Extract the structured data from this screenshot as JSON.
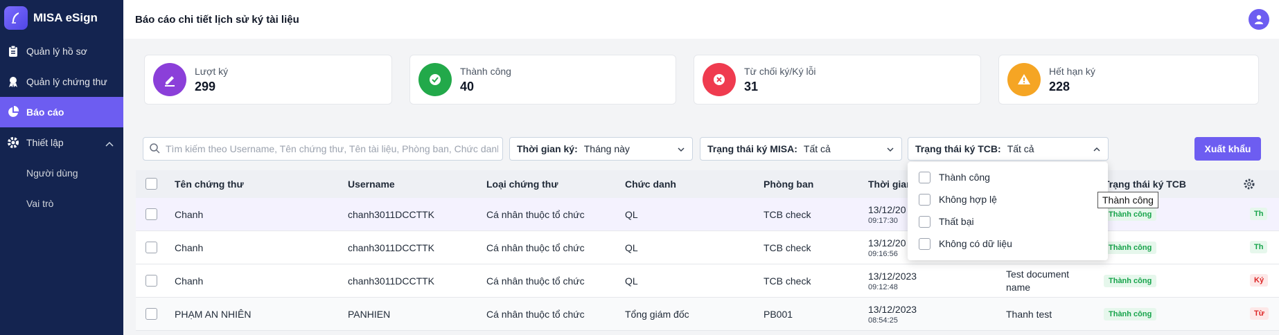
{
  "app": {
    "title": "MISA eSign"
  },
  "sidebar": {
    "items": [
      {
        "label": "Quản lý hồ sơ",
        "icon": "clipboard-icon"
      },
      {
        "label": "Quản lý chứng thư",
        "icon": "certificate-icon"
      },
      {
        "label": "Báo cáo",
        "icon": "pie-chart-icon",
        "active": true
      },
      {
        "label": "Thiết lập",
        "icon": "gear-icon",
        "expanded": true
      }
    ],
    "subitems": [
      "Người dùng",
      "Vai trò"
    ]
  },
  "header": {
    "title": "Báo cáo chi tiết lịch sử ký tài liệu"
  },
  "stats": [
    {
      "label": "Lượt ký",
      "value": "299",
      "color": "#8b3fd9",
      "icon": "signature-icon"
    },
    {
      "label": "Thành công",
      "value": "40",
      "color": "#22a94a",
      "icon": "check-circle-icon"
    },
    {
      "label": "Từ chối ký/Ký lỗi",
      "value": "31",
      "color": "#ef3b4f",
      "icon": "x-circle-icon"
    },
    {
      "label": "Hết hạn ký",
      "value": "228",
      "color": "#f5a524",
      "icon": "warning-icon"
    }
  ],
  "filters": {
    "search_placeholder": "Tìm kiếm theo Username, Tên chứng thư, Tên tài liệu, Phòng ban, Chức danh",
    "sign_time": {
      "label": "Thời gian ký:",
      "value": "Tháng này"
    },
    "misa_status": {
      "label": "Trạng thái ký MISA:",
      "value": "Tất cả"
    },
    "tcb_status": {
      "label": "Trạng thái ký TCB:",
      "value": "Tất cả"
    },
    "export_label": "Xuất khẩu"
  },
  "dropdown": {
    "options": [
      "Thành công",
      "Không hợp lệ",
      "Thất bại",
      "Không có dữ liệu"
    ],
    "tooltip": "Thành công"
  },
  "table": {
    "columns": [
      "Tên chứng thư",
      "Username",
      "Loại chứng thư",
      "Chức danh",
      "Phòng ban",
      "Thời gian",
      "",
      "Trạng thái ký TCB"
    ],
    "rows": [
      {
        "cert_name": "Chanh",
        "username": "chanh3011DCCTTK",
        "cert_type": "Cá nhân thuộc tổ chức",
        "title": "QL",
        "department": "TCB check",
        "date": "13/12/20",
        "time": "09:17:30",
        "doc_name": "",
        "tcb_status": "Thành công",
        "next": "Th"
      },
      {
        "cert_name": "Chanh",
        "username": "chanh3011DCCTTK",
        "cert_type": "Cá nhân thuộc tổ chức",
        "title": "QL",
        "department": "TCB check",
        "date": "13/12/20",
        "time": "09:16:56",
        "doc_name": "",
        "tcb_status": "Thành công",
        "next": "Th"
      },
      {
        "cert_name": "Chanh",
        "username": "chanh3011DCCTTK",
        "cert_type": "Cá nhân thuộc tổ chức",
        "title": "QL",
        "department": "TCB check",
        "date": "13/12/2023",
        "time": "09:12:48",
        "doc_name": "Test document name",
        "tcb_status": "Thành công",
        "next": "Ký"
      },
      {
        "cert_name": "PHẠM AN NHIÊN",
        "username": "PANHIEN",
        "cert_type": "Cá nhân thuộc tổ chức",
        "title": "Tổng giám đốc",
        "department": "PB001",
        "date": "13/12/2023",
        "time": "08:54:25",
        "doc_name": "Thanh test",
        "tcb_status": "Thành công",
        "next": "Từ"
      }
    ]
  },
  "colors": {
    "accent": "#6d5df1",
    "sidebar_bg": "#142450",
    "success": "#16a34a",
    "error": "#dc2626"
  }
}
